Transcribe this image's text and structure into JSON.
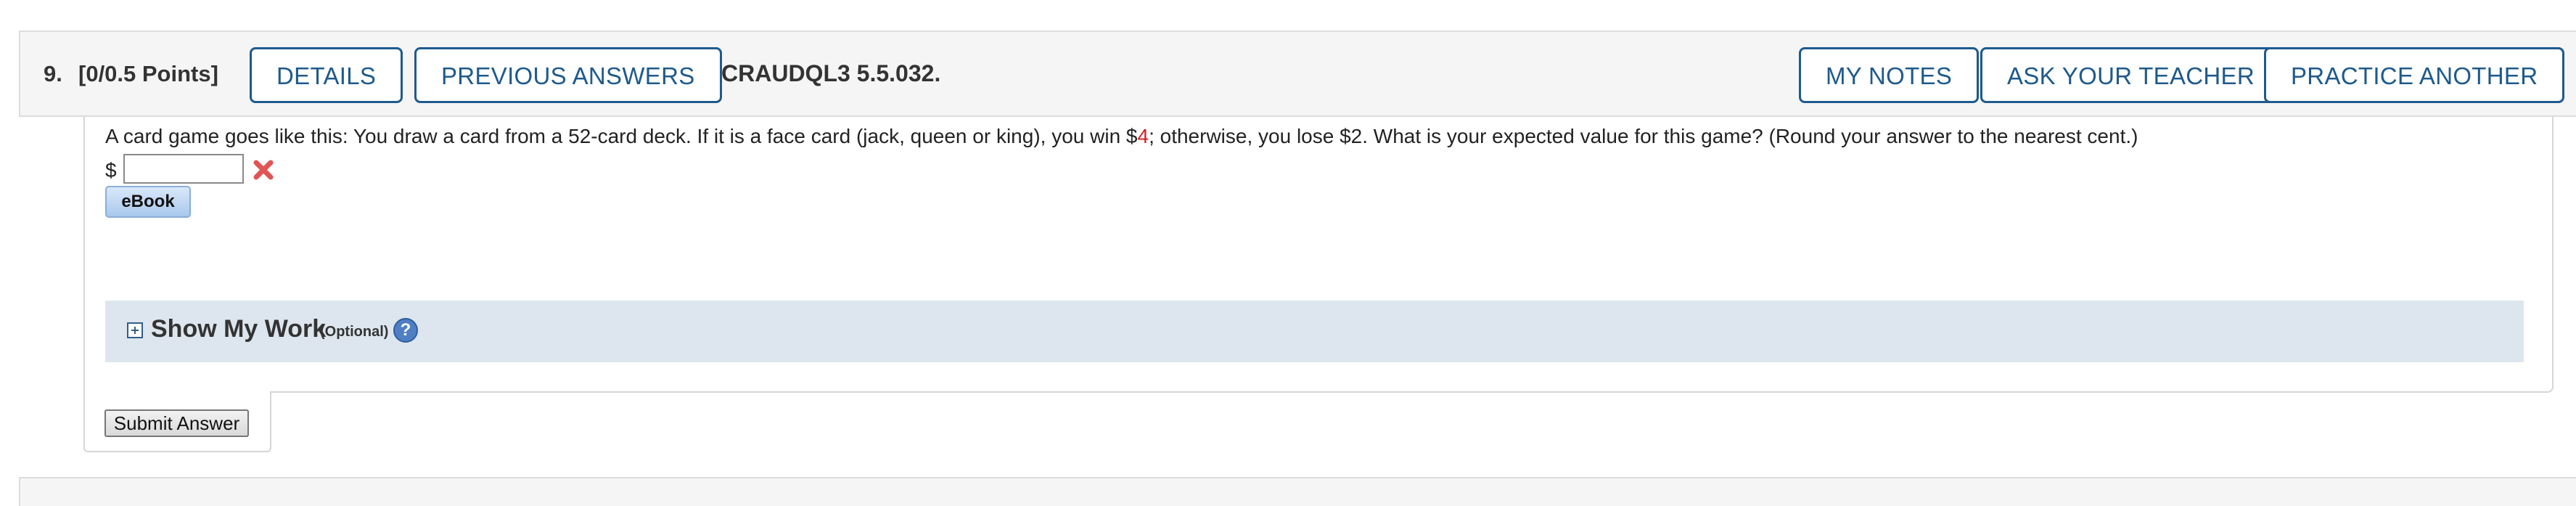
{
  "question": {
    "number": "9.",
    "points": "[0/0.5 Points]",
    "code": "CRAUDQL3 5.5.032.",
    "buttons_left": {
      "details": "DETAILS",
      "previous_answers": "PREVIOUS ANSWERS"
    },
    "buttons_right": {
      "my_notes": "MY NOTES",
      "ask_teacher": "ASK YOUR TEACHER",
      "practice_another": "PRACTICE ANOTHER"
    },
    "text_before": "A card game goes like this: You draw a card from a 52-card deck. If it is a face card (jack, queen or king), you win $",
    "highlight_value": "4",
    "text_after": "; otherwise, you lose $2. What is your expected value for this game? (Round your answer to the nearest cent.)",
    "answer": {
      "prefix": "$",
      "value": "",
      "status": "incorrect",
      "status_icon": "red-x-icon"
    },
    "ebook_label": "eBook",
    "show_my_work": {
      "title": "Show My Work",
      "optional": "(Optional)",
      "help_glyph": "?"
    },
    "submit_label": "Submit Answer"
  },
  "colors": {
    "accent": "#1e5a8c",
    "highlight_red": "#cc2222",
    "header_bg": "#f5f5f5",
    "panel_bg": "#dde6ee"
  }
}
